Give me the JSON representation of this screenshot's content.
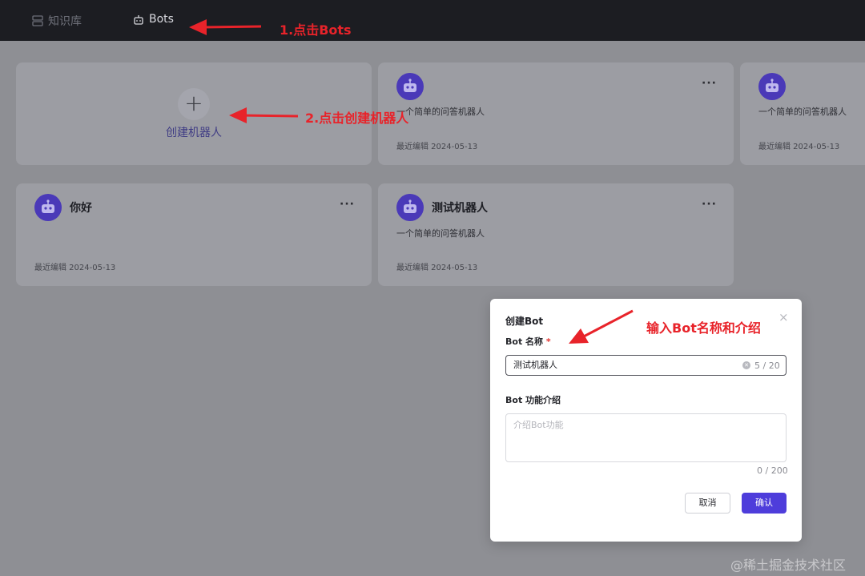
{
  "nav": {
    "knowledge_base": "知识库",
    "bots": "Bots"
  },
  "create_card": {
    "label": "创建机器人"
  },
  "bots": [
    {
      "name": "",
      "desc": "一个简单的问答机器人",
      "date": "最近编辑 2024-05-13"
    },
    {
      "name": "",
      "desc": "一个简单的问答机器人",
      "date": "最近编辑 2024-05-13"
    },
    {
      "name": "你好",
      "desc": "",
      "date": "最近编辑 2024-05-13"
    },
    {
      "name": "测试机器人",
      "desc": "一个简单的问答机器人",
      "date": "最近编辑 2024-05-13"
    }
  ],
  "more_label": "···",
  "modal": {
    "title": "创建Bot",
    "close": "×",
    "name_label": "Bot 名称",
    "required_mark": "*",
    "name_value": "测试机器人",
    "name_counter": "5 / 20",
    "desc_label": "Bot 功能介绍",
    "desc_placeholder": "介绍Bot功能",
    "desc_counter": "0 / 200",
    "cancel": "取消",
    "ok": "确认"
  },
  "annotations": {
    "step1": "1.点击Bots",
    "step2": "2.点击创建机器人",
    "step3": "输入Bot名称和介绍",
    "arrow_color": "#e8232a"
  },
  "colors": {
    "accent": "#4e3ddb",
    "avatar": "#4a39b8"
  },
  "watermark": "@稀土掘金技术社区"
}
